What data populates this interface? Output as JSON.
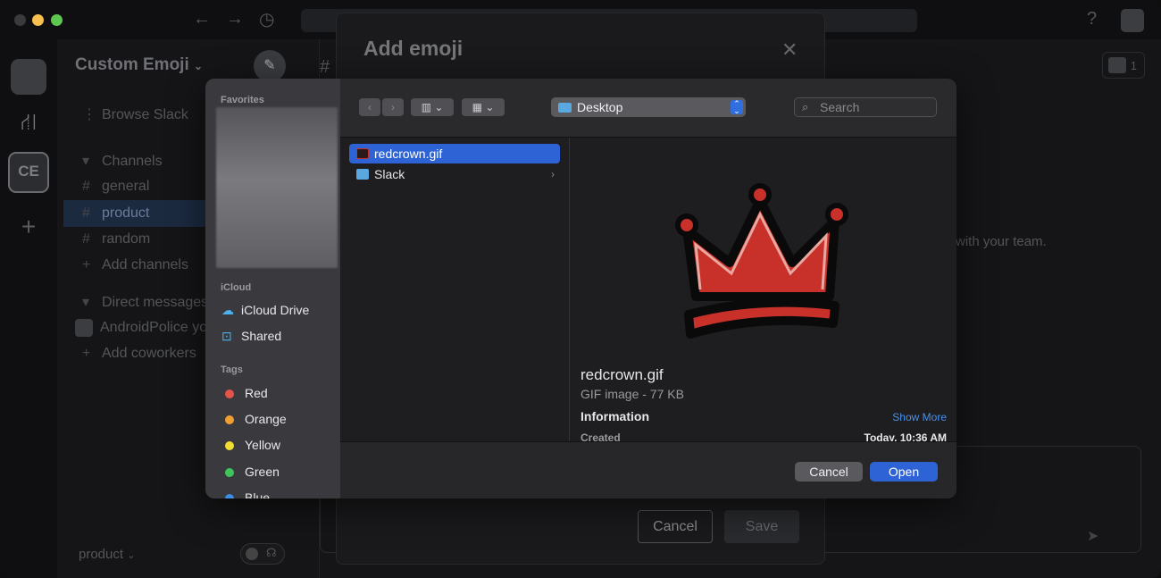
{
  "sidebar": {
    "workspace_title": "Custom Emoji",
    "browse": "Browse Slack",
    "channels_header": "Channels",
    "channels": [
      "general",
      "product",
      "random"
    ],
    "add_channels": "Add channels",
    "dm_header": "Direct messages",
    "dm_user": "AndroidPolice",
    "dm_suffix": "yo",
    "add_coworkers": "Add coworkers",
    "bottom_channel": "product",
    "workspace_badge": "CE"
  },
  "main": {
    "members_count": "1",
    "body_text": "with your team."
  },
  "modal": {
    "title": "Add emoji",
    "cancel": "Cancel",
    "save": "Save"
  },
  "dialog": {
    "favorites_header": "Favorites",
    "icloud_header": "iCloud",
    "icloud_items": [
      "iCloud Drive",
      "Shared"
    ],
    "tags_header": "Tags",
    "tags": [
      {
        "label": "Red",
        "color": "#e5534b"
      },
      {
        "label": "Orange",
        "color": "#f0a030"
      },
      {
        "label": "Yellow",
        "color": "#f2dd32"
      },
      {
        "label": "Green",
        "color": "#3ec45a"
      },
      {
        "label": "Blue",
        "color": "#3b8ee8"
      }
    ],
    "location": "Desktop",
    "search_placeholder": "Search",
    "files": [
      {
        "name": "redcrown.gif",
        "selected": true
      },
      {
        "name": "Slack",
        "selected": false
      }
    ],
    "preview": {
      "name": "redcrown.gif",
      "type": "GIF image - 77 KB",
      "information": "Information",
      "show_more": "Show More",
      "created_label": "Created",
      "created_value": "Today, 10:36 AM"
    },
    "cancel": "Cancel",
    "open": "Open"
  },
  "colors": {
    "accent_blue": "#2e63d6",
    "crown_red": "#c8302a"
  }
}
